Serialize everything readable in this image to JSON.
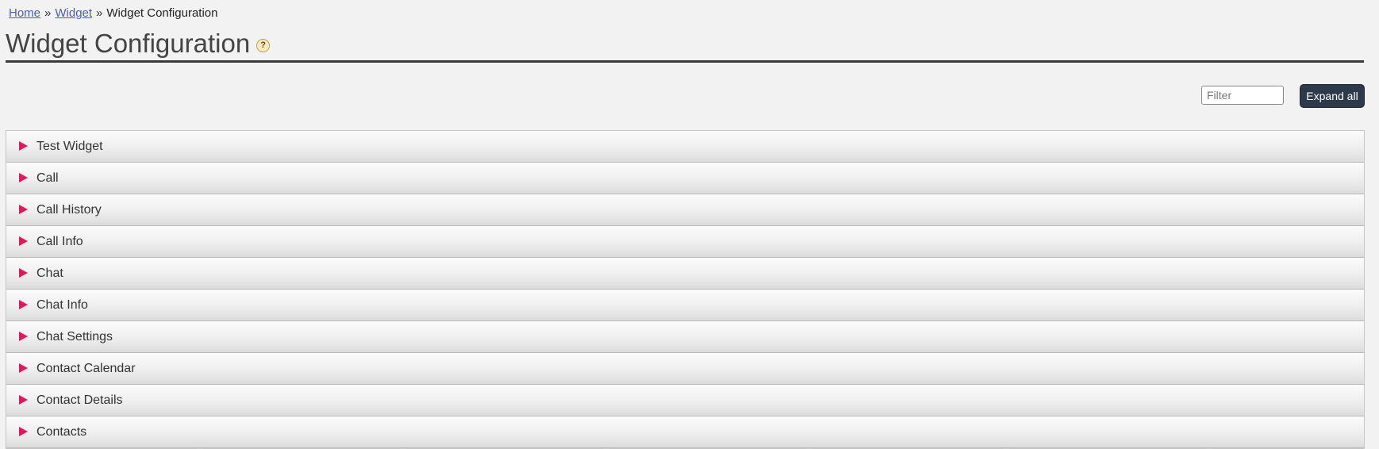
{
  "breadcrumb": {
    "home": "Home",
    "sep1": "»",
    "widget": "Widget",
    "sep2": "»",
    "current": "Widget Configuration"
  },
  "header": {
    "title": "Widget Configuration",
    "help_glyph": "?"
  },
  "toolbar": {
    "filter_placeholder": "Filter",
    "filter_value": "",
    "expand_label": "Expand all"
  },
  "accordion": {
    "items": [
      {
        "label": "Test Widget"
      },
      {
        "label": "Call"
      },
      {
        "label": "Call History"
      },
      {
        "label": "Call Info"
      },
      {
        "label": "Chat"
      },
      {
        "label": "Chat Info"
      },
      {
        "label": "Chat Settings"
      },
      {
        "label": "Contact Calendar"
      },
      {
        "label": "Contact Details"
      },
      {
        "label": "Contacts"
      }
    ]
  },
  "colors": {
    "accent_arrow": "#e0185e",
    "button_bg": "#2d3a4a",
    "link": "#4a5fb5"
  },
  "icons": {
    "help": "help-icon",
    "expand_arrow": "triangle-right-icon"
  }
}
